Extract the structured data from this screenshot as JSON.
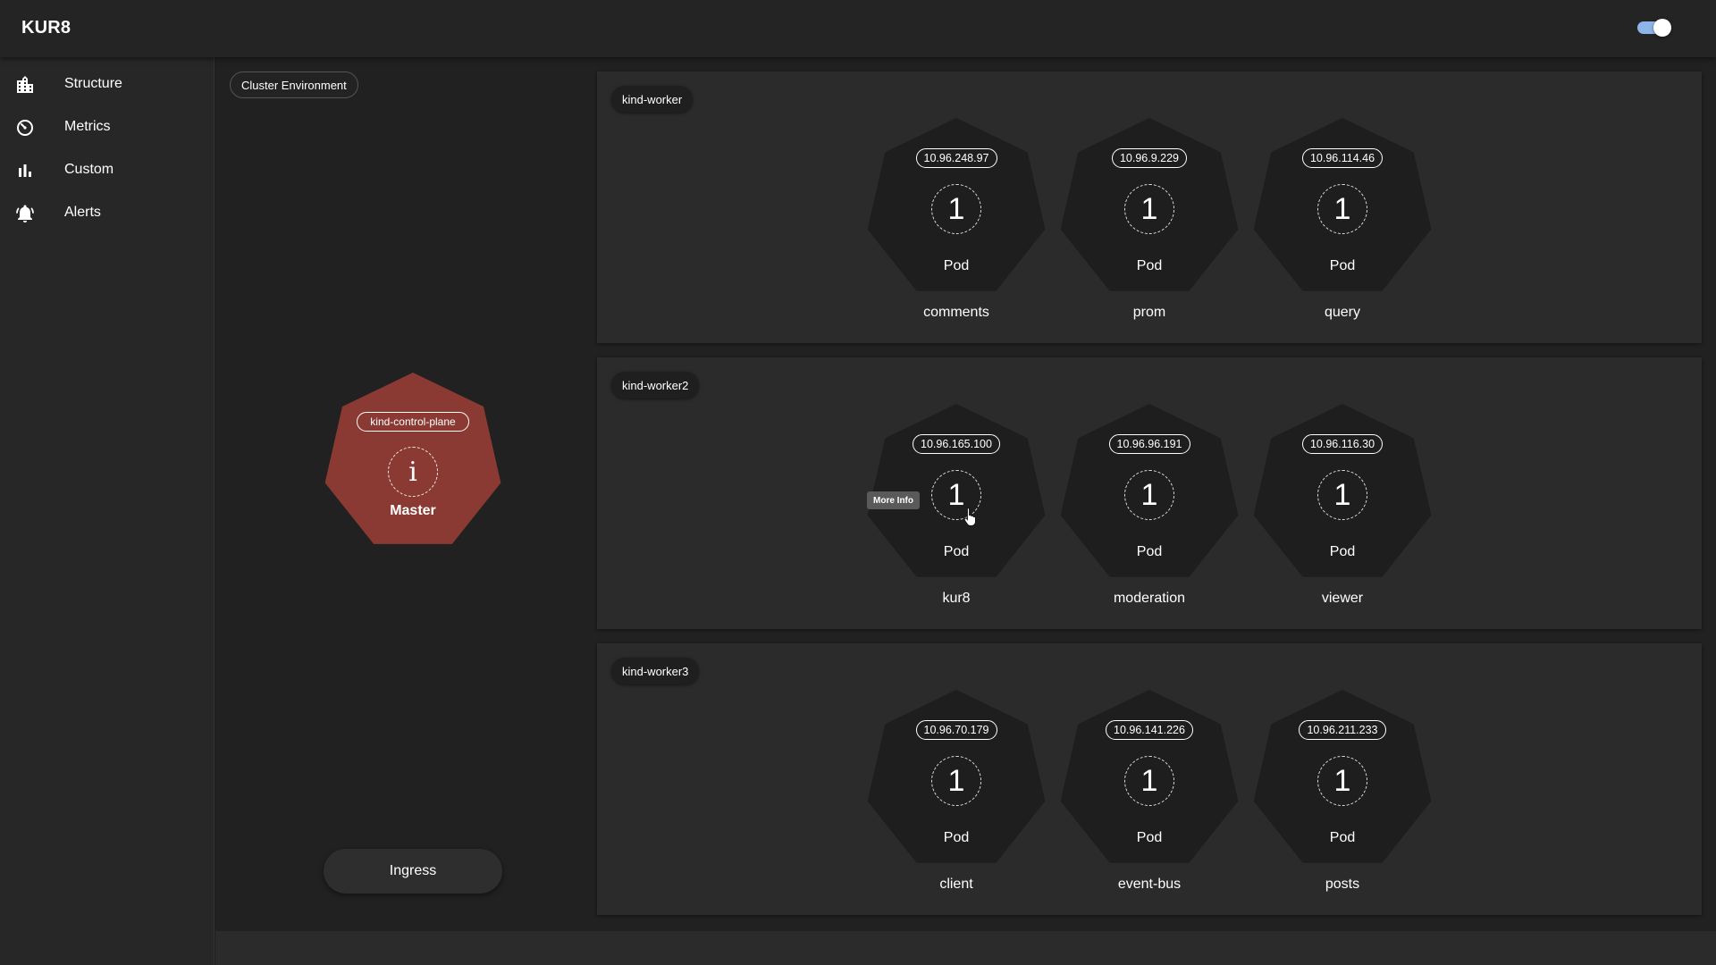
{
  "app": {
    "title": "KUR8"
  },
  "sidebar": {
    "items": [
      {
        "label": "Structure",
        "icon": "city-icon"
      },
      {
        "label": "Metrics",
        "icon": "speedometer-icon"
      },
      {
        "label": "Custom",
        "icon": "bar-chart-icon"
      },
      {
        "label": "Alerts",
        "icon": "alarm-bell-icon"
      }
    ]
  },
  "environment": {
    "chip_label": "Cluster Environment"
  },
  "control_plane": {
    "name": "kind-control-plane",
    "info_glyph": "i",
    "role": "Master",
    "color": "#8b3a33"
  },
  "ingress": {
    "label": "Ingress"
  },
  "tooltip": {
    "label": "More Info"
  },
  "nodes": [
    {
      "name": "kind-worker",
      "pods": [
        {
          "ip": "10.96.248.97",
          "count": "1",
          "kind": "Pod",
          "name": "comments"
        },
        {
          "ip": "10.96.9.229",
          "count": "1",
          "kind": "Pod",
          "name": "prom"
        },
        {
          "ip": "10.96.114.46",
          "count": "1",
          "kind": "Pod",
          "name": "query"
        }
      ]
    },
    {
      "name": "kind-worker2",
      "pods": [
        {
          "ip": "10.96.165.100",
          "count": "1",
          "kind": "Pod",
          "name": "kur8"
        },
        {
          "ip": "10.96.96.191",
          "count": "1",
          "kind": "Pod",
          "name": "moderation"
        },
        {
          "ip": "10.96.116.30",
          "count": "1",
          "kind": "Pod",
          "name": "viewer"
        }
      ]
    },
    {
      "name": "kind-worker3",
      "pods": [
        {
          "ip": "10.96.70.179",
          "count": "1",
          "kind": "Pod",
          "name": "client"
        },
        {
          "ip": "10.96.141.226",
          "count": "1",
          "kind": "Pod",
          "name": "event-bus"
        },
        {
          "ip": "10.96.211.233",
          "count": "1",
          "kind": "Pod",
          "name": "posts"
        }
      ]
    }
  ],
  "theme": {
    "toggle_on": true,
    "accent": "#8fb4e8",
    "pod_fill": "#1e1e1e"
  }
}
